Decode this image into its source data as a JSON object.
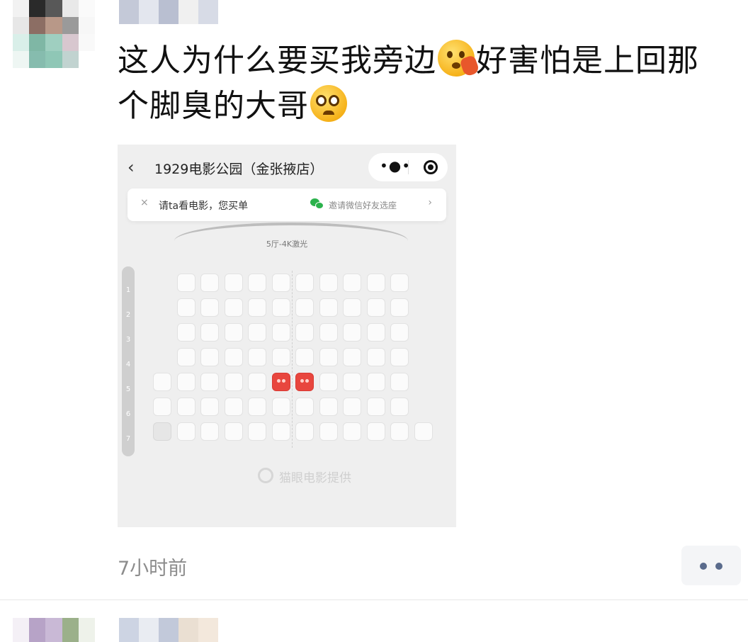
{
  "post": {
    "text_line1": "这人为什么要买我旁边",
    "emoji1": "face-with-hand-over-mouth",
    "text_line1b": "好害怕是上回那",
    "text_line2": "个脚臭的大哥",
    "emoji2": "pleading-face",
    "timestamp": "7小时前"
  },
  "screenshot": {
    "back_icon": "chevron-left-icon",
    "title": "1929电影公园（金张掖店）",
    "capsule_more": "•●•",
    "invite_close": "×",
    "invite_text": "请ta看电影，您买单",
    "invite_friends": "邀请微信好友选座",
    "invite_arrow": "›",
    "hall_name": "5厅-4K激光",
    "row_labels": [
      "1",
      "2",
      "3",
      "4",
      "5",
      "6",
      "7"
    ],
    "provider": "猫眼电影提供",
    "seat_rows": [
      {
        "row": "1",
        "seats": [
          "e",
          "e",
          "e",
          "e",
          "e",
          "e",
          "e",
          "e",
          "e",
          "e"
        ],
        "start": 1
      },
      {
        "row": "2",
        "seats": [
          "e",
          "e",
          "e",
          "e",
          "e",
          "e",
          "e",
          "e",
          "e",
          "e"
        ],
        "start": 1
      },
      {
        "row": "3",
        "seats": [
          "e",
          "e",
          "e",
          "e",
          "e",
          "e",
          "e",
          "e",
          "e",
          "e"
        ],
        "start": 1
      },
      {
        "row": "4",
        "seats": [
          "e",
          "e",
          "e",
          "e",
          "e",
          "e",
          "e",
          "e",
          "e",
          "e"
        ],
        "start": 1
      },
      {
        "row": "5",
        "seats": [
          "e",
          "e",
          "e",
          "e",
          "e",
          "s",
          "s",
          "e",
          "e",
          "e",
          "e"
        ],
        "start": 0
      },
      {
        "row": "6",
        "seats": [
          "e",
          "e",
          "e",
          "e",
          "e",
          "e",
          "e",
          "e",
          "e",
          "e",
          "e"
        ],
        "start": 0
      },
      {
        "row": "7",
        "seats": [
          "t",
          "e",
          "e",
          "e",
          "e",
          "e",
          "e",
          "e",
          "e",
          "e",
          "e",
          "e"
        ],
        "start": 0
      }
    ],
    "colors": {
      "sold": "#e8463e",
      "wechat": "#2bb24c"
    }
  },
  "actions": {
    "more_icon": "more-dots-icon"
  }
}
